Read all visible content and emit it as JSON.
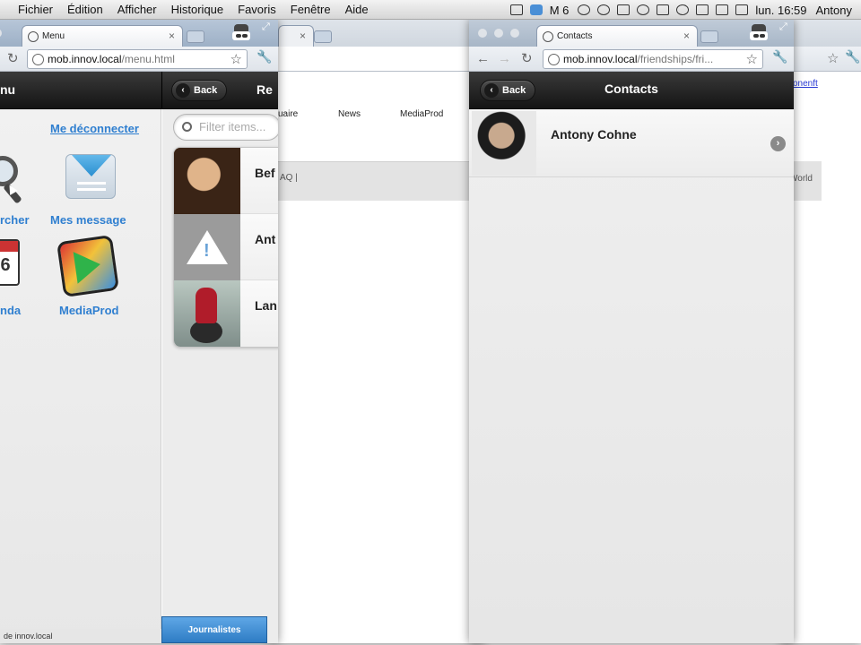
{
  "menubar": {
    "items": [
      "Fichier",
      "Édition",
      "Afficher",
      "Historique",
      "Favoris",
      "Fenêtre",
      "Aide"
    ],
    "status_text_m6": "M 6",
    "clock": "lun. 16:59",
    "user": "Antony"
  },
  "window_menu": {
    "tab_title": "Menu",
    "url_host": "mob.innov.local",
    "url_path": "/menu.html",
    "header_left": "nu",
    "back_label": "Back",
    "header_right": "Re",
    "logout_label": "Me déconnecter",
    "icons": [
      {
        "label": "rcher",
        "icon": "magnifier-icon"
      },
      {
        "label": "Mes message",
        "icon": "envelope-icon"
      },
      {
        "label": "nda",
        "icon": "calendar-icon"
      },
      {
        "label": "MediaProd",
        "icon": "film-icon"
      }
    ],
    "calendar_number": "6",
    "filter_placeholder": "Filter items...",
    "list": [
      {
        "name": "Bef"
      },
      {
        "name": "Ant"
      },
      {
        "name": "Lan"
      }
    ],
    "bottom_tab": "Journalistes",
    "status_text": "de innov.local"
  },
  "window_middle": {
    "nav": [
      "uaire",
      "News",
      "MediaProd"
    ],
    "bar_text": "AQ |"
  },
  "window_right": {
    "link_text": "onenft",
    "bar_text": "World"
  },
  "window_contacts": {
    "tab_title": "Contacts",
    "url_host": "mob.innov.local",
    "url_path": "/friendships/fri...",
    "back_label": "Back",
    "title": "Contacts",
    "contacts": [
      {
        "name": "Antony Cohne"
      }
    ]
  },
  "colors": {
    "link_blue": "#2f7fd0",
    "header_dark": "#141414",
    "tab_blue": "#2e7cc4"
  }
}
